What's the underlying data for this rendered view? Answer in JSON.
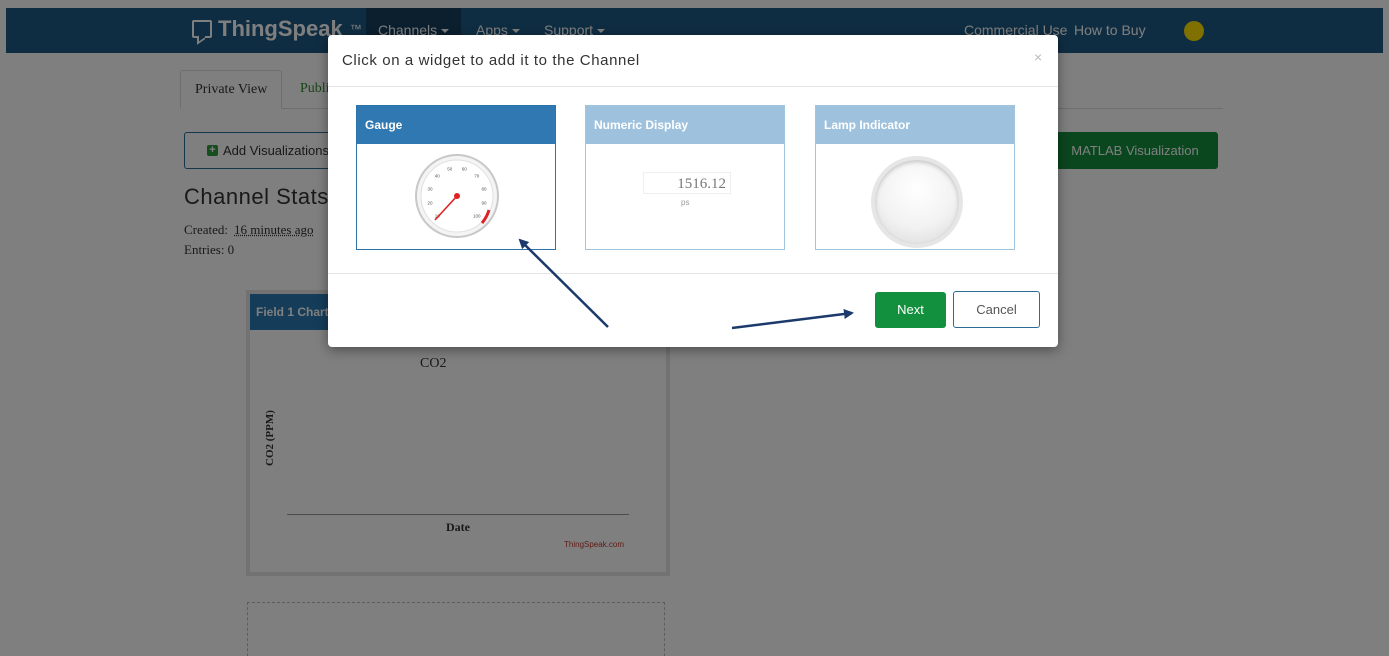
{
  "navbar": {
    "brand": "ThingSpeak",
    "brand_tm": "™",
    "items": [
      {
        "label": "Channels"
      },
      {
        "label": "Apps"
      },
      {
        "label": "Support"
      }
    ],
    "commercial_use": "Commercial Use",
    "how_to_buy": "How to Buy"
  },
  "tabs": {
    "private_view": "Private View",
    "public_view": "Public View"
  },
  "toolbar": {
    "add_visualizations": "Add Visualizations",
    "matlab_visualization": "MATLAB Visualization"
  },
  "channel": {
    "title": "Channel Stats",
    "created_label": "Created:",
    "created_value": "16 minutes ago",
    "entries": "Entries: 0"
  },
  "field_chart": {
    "header": "Field 1 Chart",
    "chart_data": {
      "type": "line",
      "title": "CO2",
      "xlabel": "Date",
      "ylabel": "CO2 (PPM)",
      "series": []
    },
    "credit": "ThingSpeak.com"
  },
  "modal": {
    "title": "Click on a widget to add it to the Channel",
    "close": "×",
    "widgets": [
      {
        "label": "Gauge"
      },
      {
        "label": "Numeric Display",
        "sample_value": "1516.12",
        "unit": "ps"
      },
      {
        "label": "Lamp Indicator"
      }
    ],
    "next": "Next",
    "cancel": "Cancel"
  },
  "gauge": {
    "ticks": [
      "10",
      "20",
      "30",
      "40",
      "50",
      "60",
      "70",
      "80",
      "90",
      "100"
    ]
  },
  "colors": {
    "navbar": "#1f5b85",
    "widget_selected": "#2f78b1",
    "widget_unselected": "#9ec2de",
    "primary_green": "#12903e",
    "arrow": "#1b3a6b"
  }
}
